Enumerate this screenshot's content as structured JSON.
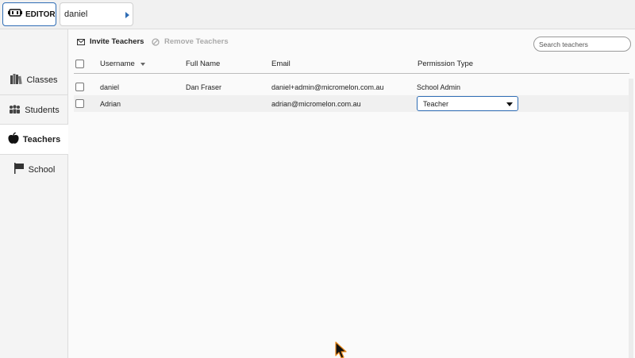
{
  "topbar": {
    "editor_label": "EDITOR",
    "selected_user": "daniel"
  },
  "sidebar": {
    "items": [
      {
        "label": "Classes",
        "icon": "books-icon",
        "active": false
      },
      {
        "label": "Students",
        "icon": "people-icon",
        "active": false
      },
      {
        "label": "Teachers",
        "icon": "apple-icon",
        "active": true
      },
      {
        "label": "School",
        "icon": "flag-icon",
        "active": false
      }
    ]
  },
  "toolbar": {
    "invite_label": "Invite Teachers",
    "remove_label": "Remove Teachers",
    "search_placeholder": "Search teachers"
  },
  "table": {
    "columns": {
      "username": "Username",
      "full_name": "Full Name",
      "email": "Email",
      "permission": "Permission Type"
    },
    "rows": [
      {
        "username": "daniel",
        "full_name": "Dan Fraser",
        "email": "daniel+admin@micromelon.com.au",
        "permission": "School Admin"
      },
      {
        "username": "Adrian",
        "full_name": "",
        "email": "adrian@micromelon.com.au",
        "permission": "Teacher"
      }
    ]
  },
  "colors": {
    "accent": "#2f6db5",
    "sidebar_bg": "#f4f4f4",
    "cursor": "#e8891a"
  }
}
